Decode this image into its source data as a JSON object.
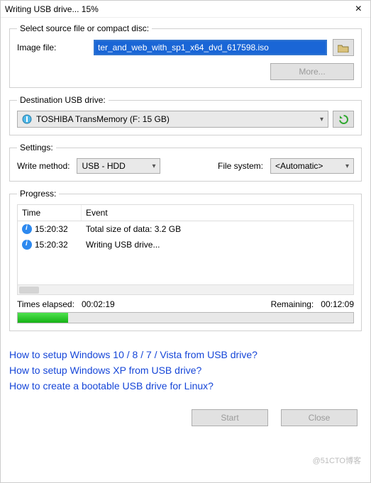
{
  "window": {
    "title": "Writing USB drive... 15%",
    "close_symbol": "×"
  },
  "source": {
    "legend": "Select source file or compact disc:",
    "image_file_label": "Image file:",
    "image_file_value": "ter_and_web_with_sp1_x64_dvd_617598.iso",
    "more_label": "More..."
  },
  "destination": {
    "legend": "Destination USB drive:",
    "drive_text": "TOSHIBA TransMemory (F: 15 GB)"
  },
  "settings": {
    "legend": "Settings:",
    "write_method_label": "Write method:",
    "write_method_value": "USB - HDD",
    "file_system_label": "File system:",
    "file_system_value": "<Automatic>"
  },
  "progress": {
    "legend": "Progress:",
    "col_time": "Time",
    "col_event": "Event",
    "rows": [
      {
        "time": "15:20:32",
        "event": "Total size of data: 3.2 GB"
      },
      {
        "time": "15:20:32",
        "event": "Writing USB drive..."
      }
    ],
    "elapsed_label": "Times elapsed:",
    "elapsed_value": "00:02:19",
    "remaining_label": "Remaining:",
    "remaining_value": "00:12:09",
    "percent": 15
  },
  "links": {
    "l1": "How to setup Windows 10 / 8 / 7 / Vista from USB drive?",
    "l2": "How to setup Windows XP from USB drive?",
    "l3": "How to create a bootable USB drive for Linux?"
  },
  "footer": {
    "start_label": "Start",
    "close_label": "Close"
  },
  "watermark": "@51CTO博客"
}
